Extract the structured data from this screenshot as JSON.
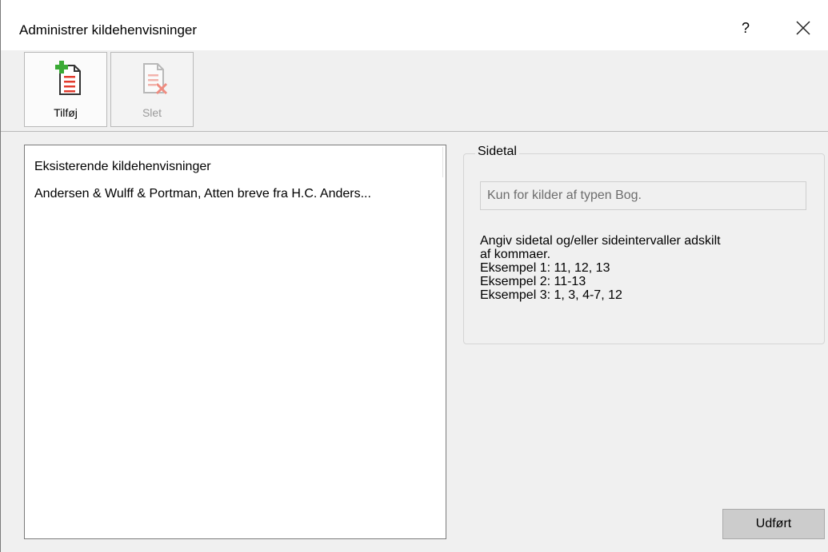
{
  "window": {
    "title": "Administrer kildehenvisninger",
    "help_label": "?",
    "close_icon": "close-icon"
  },
  "toolbar": {
    "add_label": "Tilføj",
    "add_icon": "add-document-icon",
    "delete_label": "Slet",
    "delete_icon": "delete-document-icon",
    "accent_green": "#3aaa35",
    "accent_red": "#e23b2e"
  },
  "sources": {
    "header": "Eksisterende kildehenvisninger",
    "items": [
      "Andersen & Wulff & Portman, Atten breve fra H.C. Anders..."
    ]
  },
  "pages": {
    "legend": "Sidetal",
    "placeholder": "Kun for kilder af typen Bog.",
    "help_lines": [
      "Angiv sidetal og/eller sideintervaller adskilt",
      "af kommaer.",
      "Eksempel 1: 11, 12, 13",
      "Eksempel 2: 11-13",
      "Eksempel 3: 1, 3, 4-7, 12"
    ]
  },
  "footer": {
    "done_label": "Udført"
  }
}
